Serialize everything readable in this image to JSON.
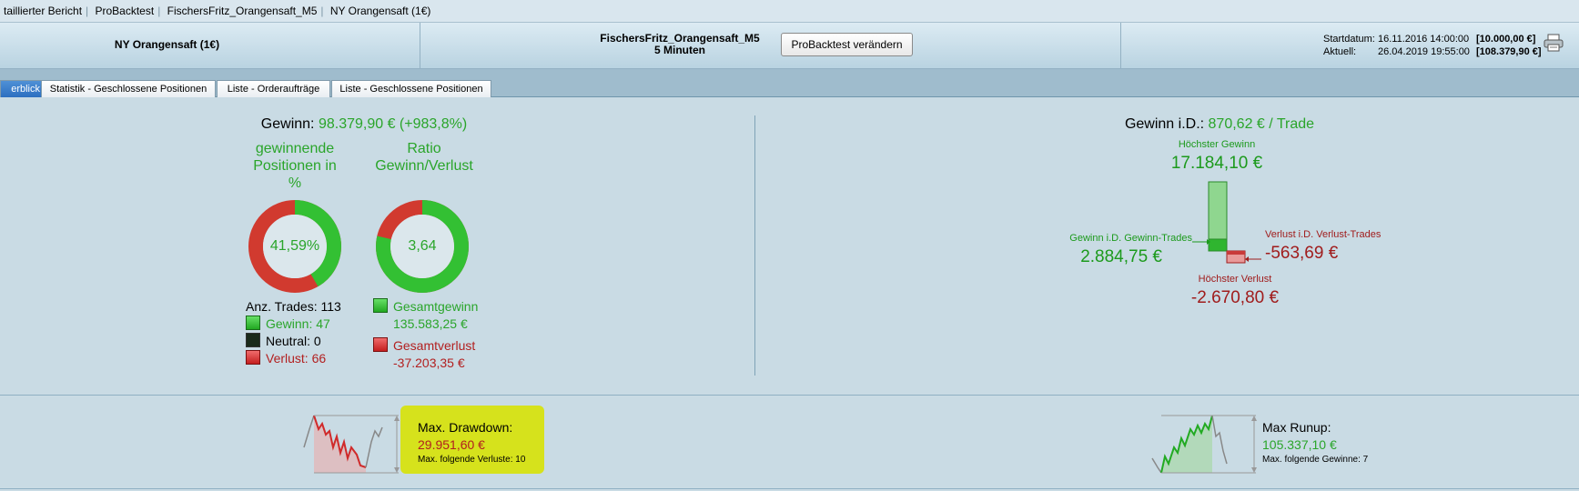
{
  "breadcrumb": [
    "taillierter Bericht",
    "ProBacktest",
    "FischersFritz_Orangensaft_M5",
    "NY Orangensaft (1€)"
  ],
  "header": {
    "instrument": "NY Orangensaft (1€)",
    "strategy_name": "FischersFritz_Orangensaft_M5",
    "timeframe": "5 Minuten",
    "change_button": "ProBacktest verändern",
    "start_label": "Startdatum:",
    "start_date": "16.11.2016 14:00:00",
    "start_value": "[10.000,00 €]",
    "current_label": "Aktuell:",
    "current_date": "26.04.2019 19:55:00",
    "current_value": "[108.379,90 €]",
    "print_icon": "printer-icon"
  },
  "tabs": [
    {
      "label": "erblick",
      "active": true
    },
    {
      "label": "Statistik - Geschlossene Positionen",
      "active": false
    },
    {
      "label": "Liste - Orderaufträge",
      "active": false
    },
    {
      "label": "Liste - Geschlossene Positionen",
      "active": false
    }
  ],
  "summary": {
    "gain_label": "Gewinn:",
    "gain_value": "98.379,90 € (+983,8%)",
    "winpct_title": [
      "gewinnende",
      "Positionen in",
      "%"
    ],
    "winpct_value": "41,59%",
    "winpct_fraction": 0.4159,
    "ratio_title": [
      "Ratio",
      "Gewinn/Verlust"
    ],
    "ratio_value": "3,64",
    "ratio_fraction": 0.785,
    "trades_label": "Anz. Trades: 113",
    "win_label": "Gewinn: 47",
    "neutral_label": "Neutral: 0",
    "loss_label": "Verlust: 66",
    "total_gain_label": "Gesamtgewinn",
    "total_gain_value": "135.583,25 €",
    "total_loss_label": "Gesamtverlust",
    "total_loss_value": "-37.203,35 €"
  },
  "average": {
    "label": "Gewinn i.D.:",
    "value": "870,62 € / Trade",
    "max_gain_label": "Höchster Gewinn",
    "max_gain_value": "17.184,10 €",
    "avg_win_label": "Gewinn i.D. Gewinn-Trades",
    "avg_win_value": "2.884,75 €",
    "avg_loss_label": "Verlust i.D. Verlust-Trades",
    "avg_loss_value": "-563,69 €",
    "max_loss_label": "Höchster Verlust",
    "max_loss_value": "-2.670,80 €"
  },
  "drawdown": {
    "label": "Max. Drawdown:",
    "value": "29.951,60 €",
    "sub": "Max. folgende Verluste: 10"
  },
  "runup": {
    "label": "Max Runup:",
    "value": "105.337,10 €",
    "sub": "Max. folgende Gewinne: 7"
  },
  "colors": {
    "green": "#2aa52a",
    "red": "#b21f1f",
    "background": "#c9dbe4",
    "highlight": "#d6e21c"
  }
}
